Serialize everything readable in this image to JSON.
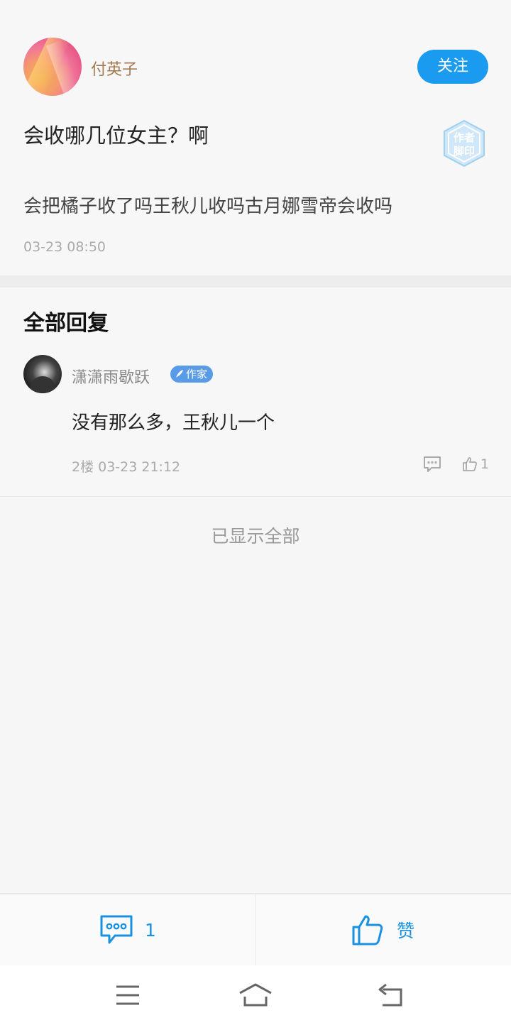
{
  "post": {
    "author": "付英子",
    "follow_label": "关注",
    "title": "会收哪几位女主？啊",
    "seal_line1": "作者",
    "seal_line2": "脚印",
    "body": "会把橘子收了吗王秋儿收吗古月娜雪帝会收吗",
    "time": "03-23 08:50"
  },
  "replies": {
    "heading": "全部回复",
    "items": [
      {
        "name": "潇潇雨歇跃",
        "badge": "作家",
        "text": "没有那么多，王秋儿一个",
        "meta": "2楼 03-23 21:12",
        "likes": "1"
      }
    ],
    "all_shown": "已显示全部"
  },
  "bottom_bar": {
    "comment_count": "1",
    "like_label": "赞"
  },
  "colors": {
    "accent": "#1a9bf0",
    "author_name": "#a47a50",
    "badge": "#5a9be8"
  },
  "icons": {
    "comment": "comment-bubble-icon",
    "like": "thumbs-up-icon",
    "menu": "menu-icon",
    "home": "home-icon",
    "back": "back-icon"
  }
}
